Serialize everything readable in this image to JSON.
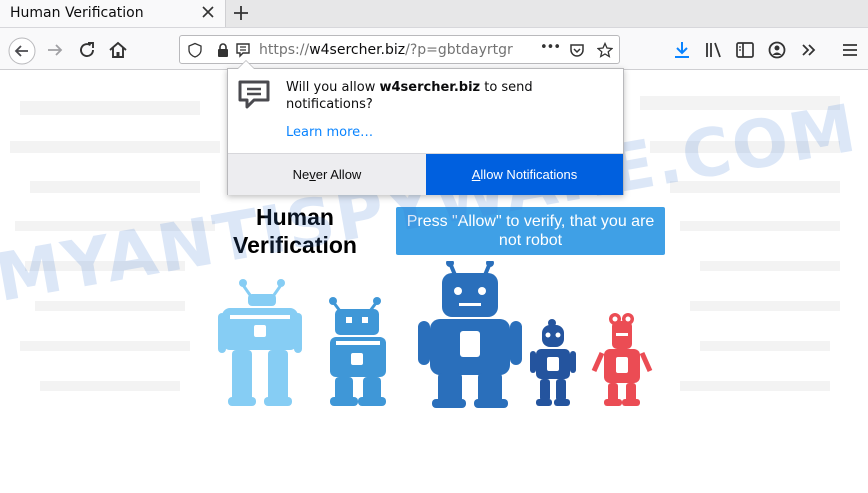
{
  "tab": {
    "title": "Human Verification"
  },
  "urlbar": {
    "scheme": "https://",
    "host": "w4sercher.biz",
    "path": "/?p=gbtdayrtgr",
    "more_glyph": "•••"
  },
  "popup": {
    "message_before": "Will you allow ",
    "site": "w4sercher.biz",
    "message_after": " to send notifications?",
    "learn_more": "Learn more…",
    "never_pre": "Ne",
    "never_key": "v",
    "never_post": "er Allow",
    "allow_key": "A",
    "allow_post": "llow Notifications"
  },
  "page": {
    "heading_line1": "Human",
    "heading_line2": "Verification",
    "badge_line1": "Press \"Allow\" to verify, that you are",
    "badge_line2": "not robot",
    "watermark": "MYANTISPYWARE.COM"
  },
  "colors": {
    "accent": "#0060df",
    "badge": "#3fa0e6",
    "robot_light": "#86cdf4",
    "robot_mid": "#3f97d7",
    "robot_dark": "#2a6fbb",
    "robot_navy": "#24549e",
    "robot_red": "#eb4c54"
  },
  "icons": [
    "close-icon",
    "plus-icon",
    "back-icon",
    "forward-icon",
    "reload-icon",
    "home-icon",
    "info-icon",
    "lock-icon",
    "notification-permission-icon",
    "page-actions-icon",
    "pocket-icon",
    "bookmark-star-icon",
    "download-icon",
    "library-icon",
    "sidebar-icon",
    "account-icon",
    "overflow-icon",
    "menu-icon"
  ]
}
